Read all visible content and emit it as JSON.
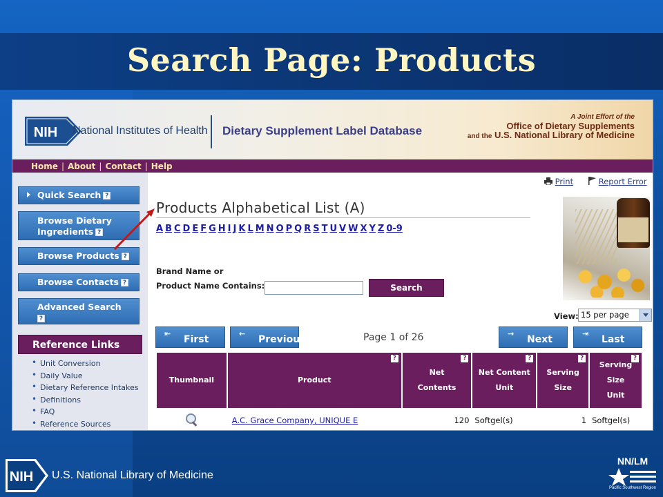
{
  "slide": {
    "title": "Search Page: Products"
  },
  "banner": {
    "nih_logo": "NIH",
    "nih_name": "National Institutes of Health",
    "db_name": "Dietary Supplement Label Database",
    "joint_line1": "A Joint Effort of the",
    "joint_line2": "Office of Dietary Supplements",
    "joint_line3_prefix": "and the",
    "joint_line3": "U.S. National Library of Medicine"
  },
  "topnav": {
    "items": [
      "Home",
      "About",
      "Contact",
      "Help"
    ],
    "separator": "|"
  },
  "sidebar": {
    "buttons": [
      "Quick Search",
      "Browse Dietary Ingredients",
      "Browse Products",
      "Browse Contacts",
      "Advanced Search"
    ],
    "help_glyph": "?",
    "ref_heading": "Reference Links",
    "ref_links": [
      "Unit Conversion",
      "Daily Value",
      "Dietary Reference Intakes",
      "Definitions",
      "FAQ",
      "Reference Sources"
    ]
  },
  "tools": {
    "print": "Print",
    "report": "Report Error"
  },
  "main": {
    "title": "Products Alphabetical List (A)",
    "letters": [
      "A",
      "B",
      "C",
      "D",
      "E",
      "F",
      "G",
      "H",
      "I",
      "J",
      "K",
      "L",
      "M",
      "N",
      "O",
      "P",
      "Q",
      "R",
      "S",
      "T",
      "U",
      "V",
      "W",
      "X",
      "Y",
      "Z",
      "0-9"
    ]
  },
  "search": {
    "label_line1": "Brand Name or",
    "label_line2": "Product Name Contains:",
    "value": "",
    "button": "Search"
  },
  "view": {
    "label": "View:",
    "selected": "15 per page"
  },
  "pager": {
    "first": "First",
    "previous": "Previous",
    "info": "Page 1 of 26",
    "next": "Next",
    "last": "Last"
  },
  "table": {
    "headers": [
      {
        "lines": [
          "Thumbnail"
        ],
        "help": false
      },
      {
        "lines": [
          "Product"
        ],
        "help": true
      },
      {
        "lines": [
          "Net",
          "Contents"
        ],
        "help": true
      },
      {
        "lines": [
          "Net Content",
          "Unit"
        ],
        "help": true
      },
      {
        "lines": [
          "Serving",
          "Size"
        ],
        "help": true
      },
      {
        "lines": [
          "Serving",
          "Size",
          "Unit"
        ],
        "help": true
      }
    ],
    "rows": [
      {
        "product": "A.C. Grace Company, UNIQUE E",
        "net_contents": "120",
        "net_unit": "Softgel(s)",
        "serving_size": "1",
        "serving_unit": "Softgel(s)"
      }
    ]
  },
  "footer": {
    "nih_logo": "NIH",
    "nlm": "U.S. National Library of Medicine",
    "nnlm": "NN/LM",
    "region": "Pacific Southwest Region"
  },
  "colors": {
    "background": "#0f4c98",
    "title": "#fff6c2",
    "purple": "#6b1e5e",
    "button_blue": "#2f6db3",
    "link": "#1d1daa",
    "arrow": "#c41818"
  },
  "icons": {
    "print": "printer-icon",
    "report": "flag-icon",
    "thumbnail": "magnifier-icon",
    "arrow": "annotation-arrow"
  }
}
